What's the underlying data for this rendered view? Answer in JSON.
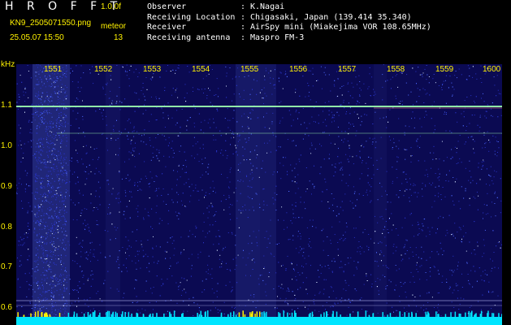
{
  "header": {
    "title": "H R O F F T",
    "version": "1.0.0f",
    "filename": "KN9_2505071550.png",
    "meteo_label": "meteor",
    "datetime": "25.05.07 15:50",
    "count": "13",
    "info": [
      {
        "key": "Observer",
        "sep": ":",
        "value": "K.Nagai"
      },
      {
        "key": "Receiving Location",
        "sep": ":",
        "value": "Chigasaki, Japan (139.414 35.340)"
      },
      {
        "key": "Receiver",
        "sep": ":",
        "value": "AirSpy mini (Miakejima VOR 108.65MHz)"
      },
      {
        "key": "Receiving antenna",
        "sep": ":",
        "value": "Maspro FM-3"
      }
    ]
  },
  "spectrogram": {
    "y_unit": "kHz",
    "y_ticks": [
      "1.1",
      "1.0",
      "0.9",
      "0.8",
      "0.7",
      "0.6"
    ],
    "x_ticks": [
      "1551",
      "1552",
      "1553",
      "1554",
      "1555",
      "1556",
      "1557",
      "1558",
      "1559",
      "1600"
    ],
    "colors": {
      "background": "#0b0a52",
      "axis_label": "#fff200",
      "carrier": "#9fffb0",
      "noise_floor": "#00e5ff"
    }
  }
}
